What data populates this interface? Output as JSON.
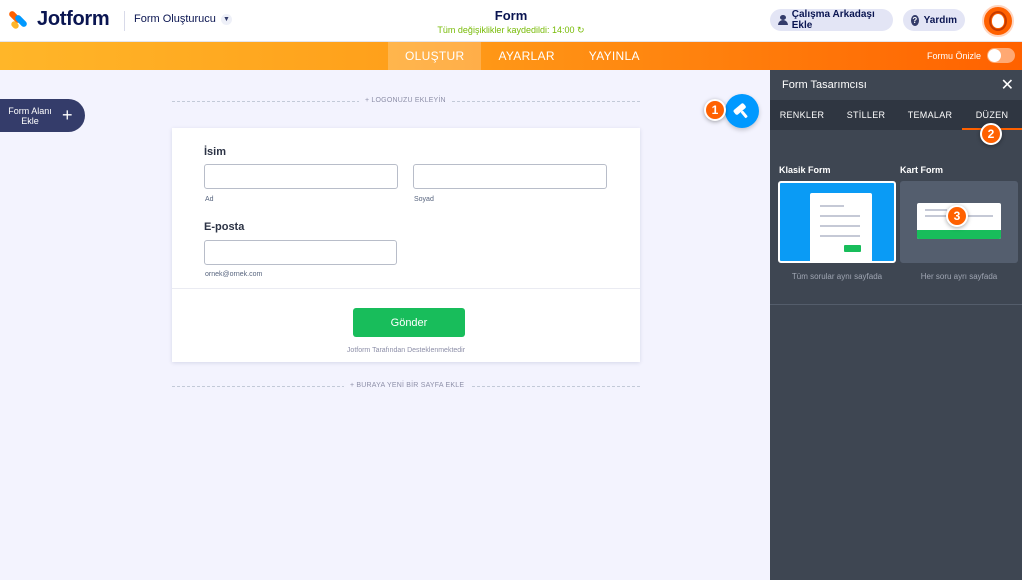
{
  "header": {
    "brand": "Jotform",
    "builder_dropdown": "Form Oluşturucu",
    "form_title": "Form",
    "save_status": "Tüm değişiklikler kaydedildi: 14:00",
    "invite_label": "Çalışma Arkadaşı Ekle",
    "help_label": "Yardım"
  },
  "nav": {
    "tabs": [
      {
        "label": "OLUŞTUR",
        "active": true
      },
      {
        "label": "AYARLAR",
        "active": false
      },
      {
        "label": "YAYINLA",
        "active": false
      }
    ],
    "preview_label": "Formu Önizle",
    "preview_on": false
  },
  "sidebar": {
    "add_element_label": "Form Alanı Ekle"
  },
  "canvas": {
    "add_logo": "+ LOGONUZU EKLEYİN",
    "add_page": "+ BURAYA YENİ BİR SAYFA EKLE",
    "fields": {
      "name_label": "İsim",
      "first_sublabel": "Ad",
      "last_sublabel": "Soyad",
      "email_label": "E-posta",
      "email_sublabel": "ornek@ornek.com"
    },
    "submit_label": "Gönder",
    "powered_by": "Jotform Tarafından Desteklenmektedir"
  },
  "designer": {
    "title": "Form Tasarımcısı",
    "tabs": [
      {
        "label": "RENKLER",
        "active": false
      },
      {
        "label": "STİLLER",
        "active": false
      },
      {
        "label": "TEMALAR",
        "active": false
      },
      {
        "label": "DÜZEN",
        "active": true
      }
    ],
    "layouts": [
      {
        "title": "Klasik Form",
        "caption": "Tüm sorular aynı sayfada",
        "selected": true
      },
      {
        "title": "Kart Form",
        "caption": "Her soru ayrı sayfada",
        "selected": false
      }
    ]
  },
  "callouts": [
    "1",
    "2",
    "3"
  ],
  "colors": {
    "accent_orange": "#ff6100",
    "accent_blue": "#0099ff",
    "submit_green": "#18bd5b",
    "panel_bg": "#3e4652"
  },
  "icons": {
    "logo": "jotform-logo-icon",
    "dropdown": "chevron-down-icon",
    "refresh": "refresh-icon",
    "invite": "user-icon",
    "help": "help-circle-icon",
    "add": "plus-icon",
    "designer": "paint-roller-icon",
    "close": "close-icon"
  }
}
